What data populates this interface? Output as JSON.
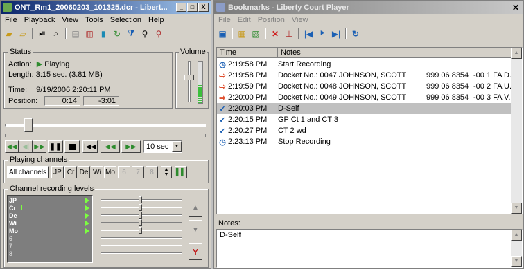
{
  "left_window": {
    "title": "ONT_Rm1_20060203_101325.dcr - Libert...",
    "title_buttons": [
      "_",
      "□",
      "X"
    ],
    "menu": [
      "File",
      "Playback",
      "View",
      "Tools",
      "Selection",
      "Help"
    ],
    "status": {
      "group_label": "Status",
      "action_label": "Action:",
      "action_value": "Playing",
      "length_text": "Length: 3:15 sec. (3.81 MB)",
      "time_label": "Time:",
      "time_value": "9/19/2006 2:20:11 PM",
      "position_label": "Position:",
      "position_elapsed": "0:14",
      "position_remaining": "-3:01"
    },
    "volume_label": "Volume",
    "skip_select_value": "10 sec",
    "playing_channels": {
      "group_label": "Playing channels",
      "all_label": "All channels",
      "channels": [
        "JP",
        "Cr",
        "De",
        "Wi",
        "Mo",
        "6",
        "7",
        "8"
      ]
    },
    "recording_levels": {
      "group_label": "Channel recording levels",
      "channels": [
        "JP",
        "Cr",
        "De",
        "Wi",
        "Mo",
        "6",
        "7",
        "8"
      ]
    }
  },
  "right_window": {
    "title": "Bookmarks - Liberty Court Player",
    "close_glyph": "✕",
    "menu": [
      "File",
      "Edit",
      "Position",
      "View"
    ],
    "columns": [
      "Time",
      "Notes"
    ],
    "rows": [
      {
        "icon": "clock-icon",
        "time": "2:19:58 PM",
        "note": "Start Recording",
        "extra1": "",
        "extra2": ""
      },
      {
        "icon": "arrow-icon",
        "time": "2:19:58 PM",
        "note": "Docket No.: 0047 JOHNSON, SCOTT",
        "extra1": "999 06 8354",
        "extra2": "-00 1 FA D..."
      },
      {
        "icon": "arrow-icon",
        "time": "2:19:59 PM",
        "note": "Docket No.: 0048 JOHNSON, SCOTT",
        "extra1": "999 06 8354",
        "extra2": "-00 2 FA U..."
      },
      {
        "icon": "arrow-icon",
        "time": "2:20:00 PM",
        "note": "Docket No.: 0049 JOHNSON, SCOTT",
        "extra1": "999 06 8354",
        "extra2": "-00 3 FA V..."
      },
      {
        "icon": "check-icon",
        "time": "2:20:03 PM",
        "note": "D-Self",
        "extra1": "",
        "extra2": ""
      },
      {
        "icon": "check-icon",
        "time": "2:20:15 PM",
        "note": "GP Ct 1 and CT 3",
        "extra1": "",
        "extra2": ""
      },
      {
        "icon": "check-icon",
        "time": "2:20:27 PM",
        "note": "CT 2 wd",
        "extra1": "",
        "extra2": ""
      },
      {
        "icon": "clock-icon",
        "time": "2:23:13 PM",
        "note": "Stop Recording",
        "extra1": "",
        "extra2": ""
      }
    ],
    "selected_row": 4,
    "notes_label": "Notes:",
    "notes_text": "D-Self"
  },
  "colors": {
    "active_title": "#0a246a",
    "inactive_title": "#7a7a7a",
    "play_green": "#2e8b2e",
    "marker_red": "#e05030",
    "check_blue": "#1a5fb4"
  }
}
